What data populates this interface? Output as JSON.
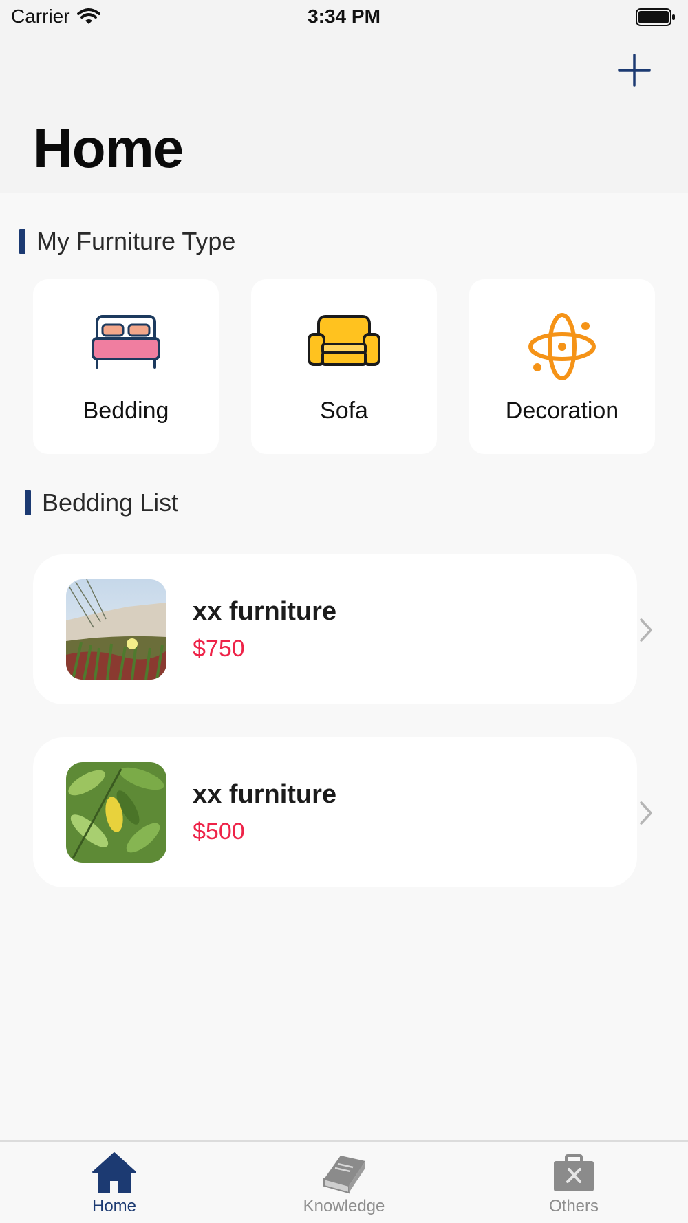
{
  "status_bar": {
    "carrier": "Carrier",
    "time": "3:34 PM"
  },
  "header": {
    "title": "Home",
    "add_icon": "plus-icon"
  },
  "furniture_types": {
    "heading": "My Furniture Type",
    "items": [
      {
        "label": "Bedding",
        "icon": "bed-icon"
      },
      {
        "label": "Sofa",
        "icon": "sofa-icon"
      },
      {
        "label": "Decoration",
        "icon": "decoration-icon"
      }
    ]
  },
  "bedding_list": {
    "heading": "Bedding List",
    "items": [
      {
        "name": "xx furniture",
        "price": "$750",
        "image": "beach-grass-flower-photo"
      },
      {
        "name": "xx furniture",
        "price": "$500",
        "image": "green-leaves-photo"
      }
    ]
  },
  "tabs": [
    {
      "label": "Home",
      "icon": "home-icon",
      "active": true
    },
    {
      "label": "Knowledge",
      "icon": "book-icon",
      "active": false
    },
    {
      "label": "Others",
      "icon": "toolbox-icon",
      "active": false
    }
  ],
  "colors": {
    "accent": "#1c3a72",
    "price": "#ee2348",
    "background": "#f8f8f8"
  }
}
